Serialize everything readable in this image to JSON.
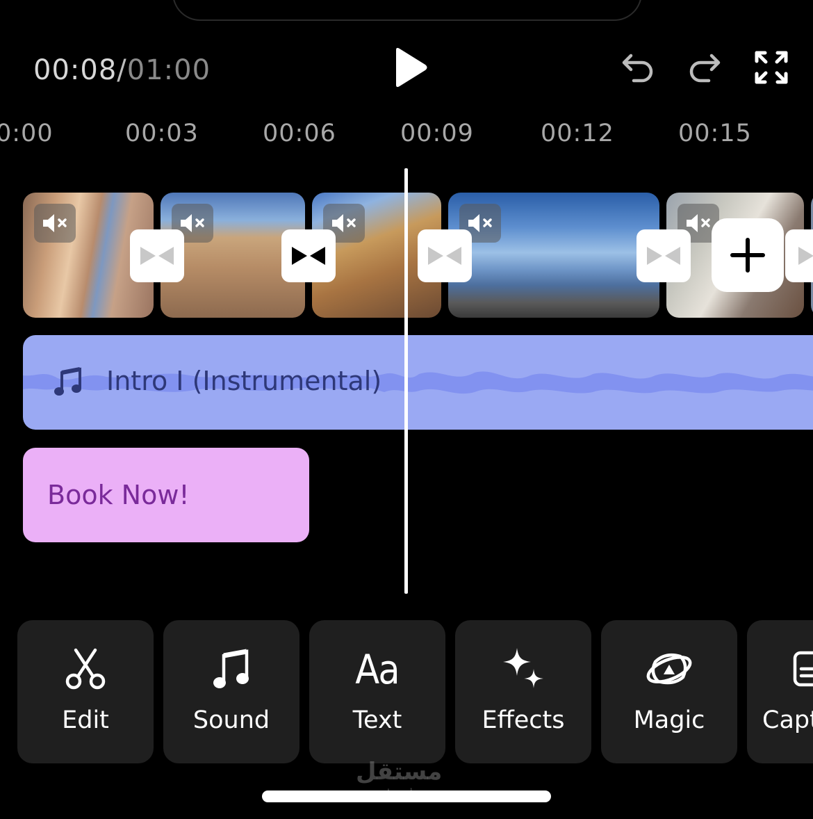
{
  "header": {
    "current_time": "00:08",
    "separator": "/",
    "total_time": "01:00",
    "play_icon": "play-icon",
    "undo_icon": "undo-icon",
    "redo_icon": "redo-icon",
    "fullscreen_icon": "fullscreen-icon"
  },
  "ruler": {
    "ticks": [
      "0:00",
      "00:03",
      "00:06",
      "00:09",
      "00:12",
      "00:15"
    ]
  },
  "timeline": {
    "clips_muted": true,
    "mute_icon": "mute-icon",
    "transition_icon": "bowtie-transition-icon",
    "add_icon": "plus-icon",
    "audio": {
      "label": "Intro I (Instrumental)",
      "icon": "music-note-icon",
      "color": "#9aa9f3"
    },
    "text_overlay": {
      "label": "Book Now!",
      "color": "#ebb0f7"
    }
  },
  "toolbar": {
    "items": [
      {
        "label": "Edit",
        "icon": "scissors-icon"
      },
      {
        "label": "Sound",
        "icon": "music-note-icon"
      },
      {
        "label": "Text",
        "icon": "text-aa-icon"
      },
      {
        "label": "Effects",
        "icon": "sparkles-icon"
      },
      {
        "label": "Magic",
        "icon": "magic-orbit-icon"
      },
      {
        "label": "Capt",
        "icon": "captions-icon"
      }
    ]
  },
  "watermark": {
    "text": "مستقل",
    "sub": "mostaql.com"
  }
}
